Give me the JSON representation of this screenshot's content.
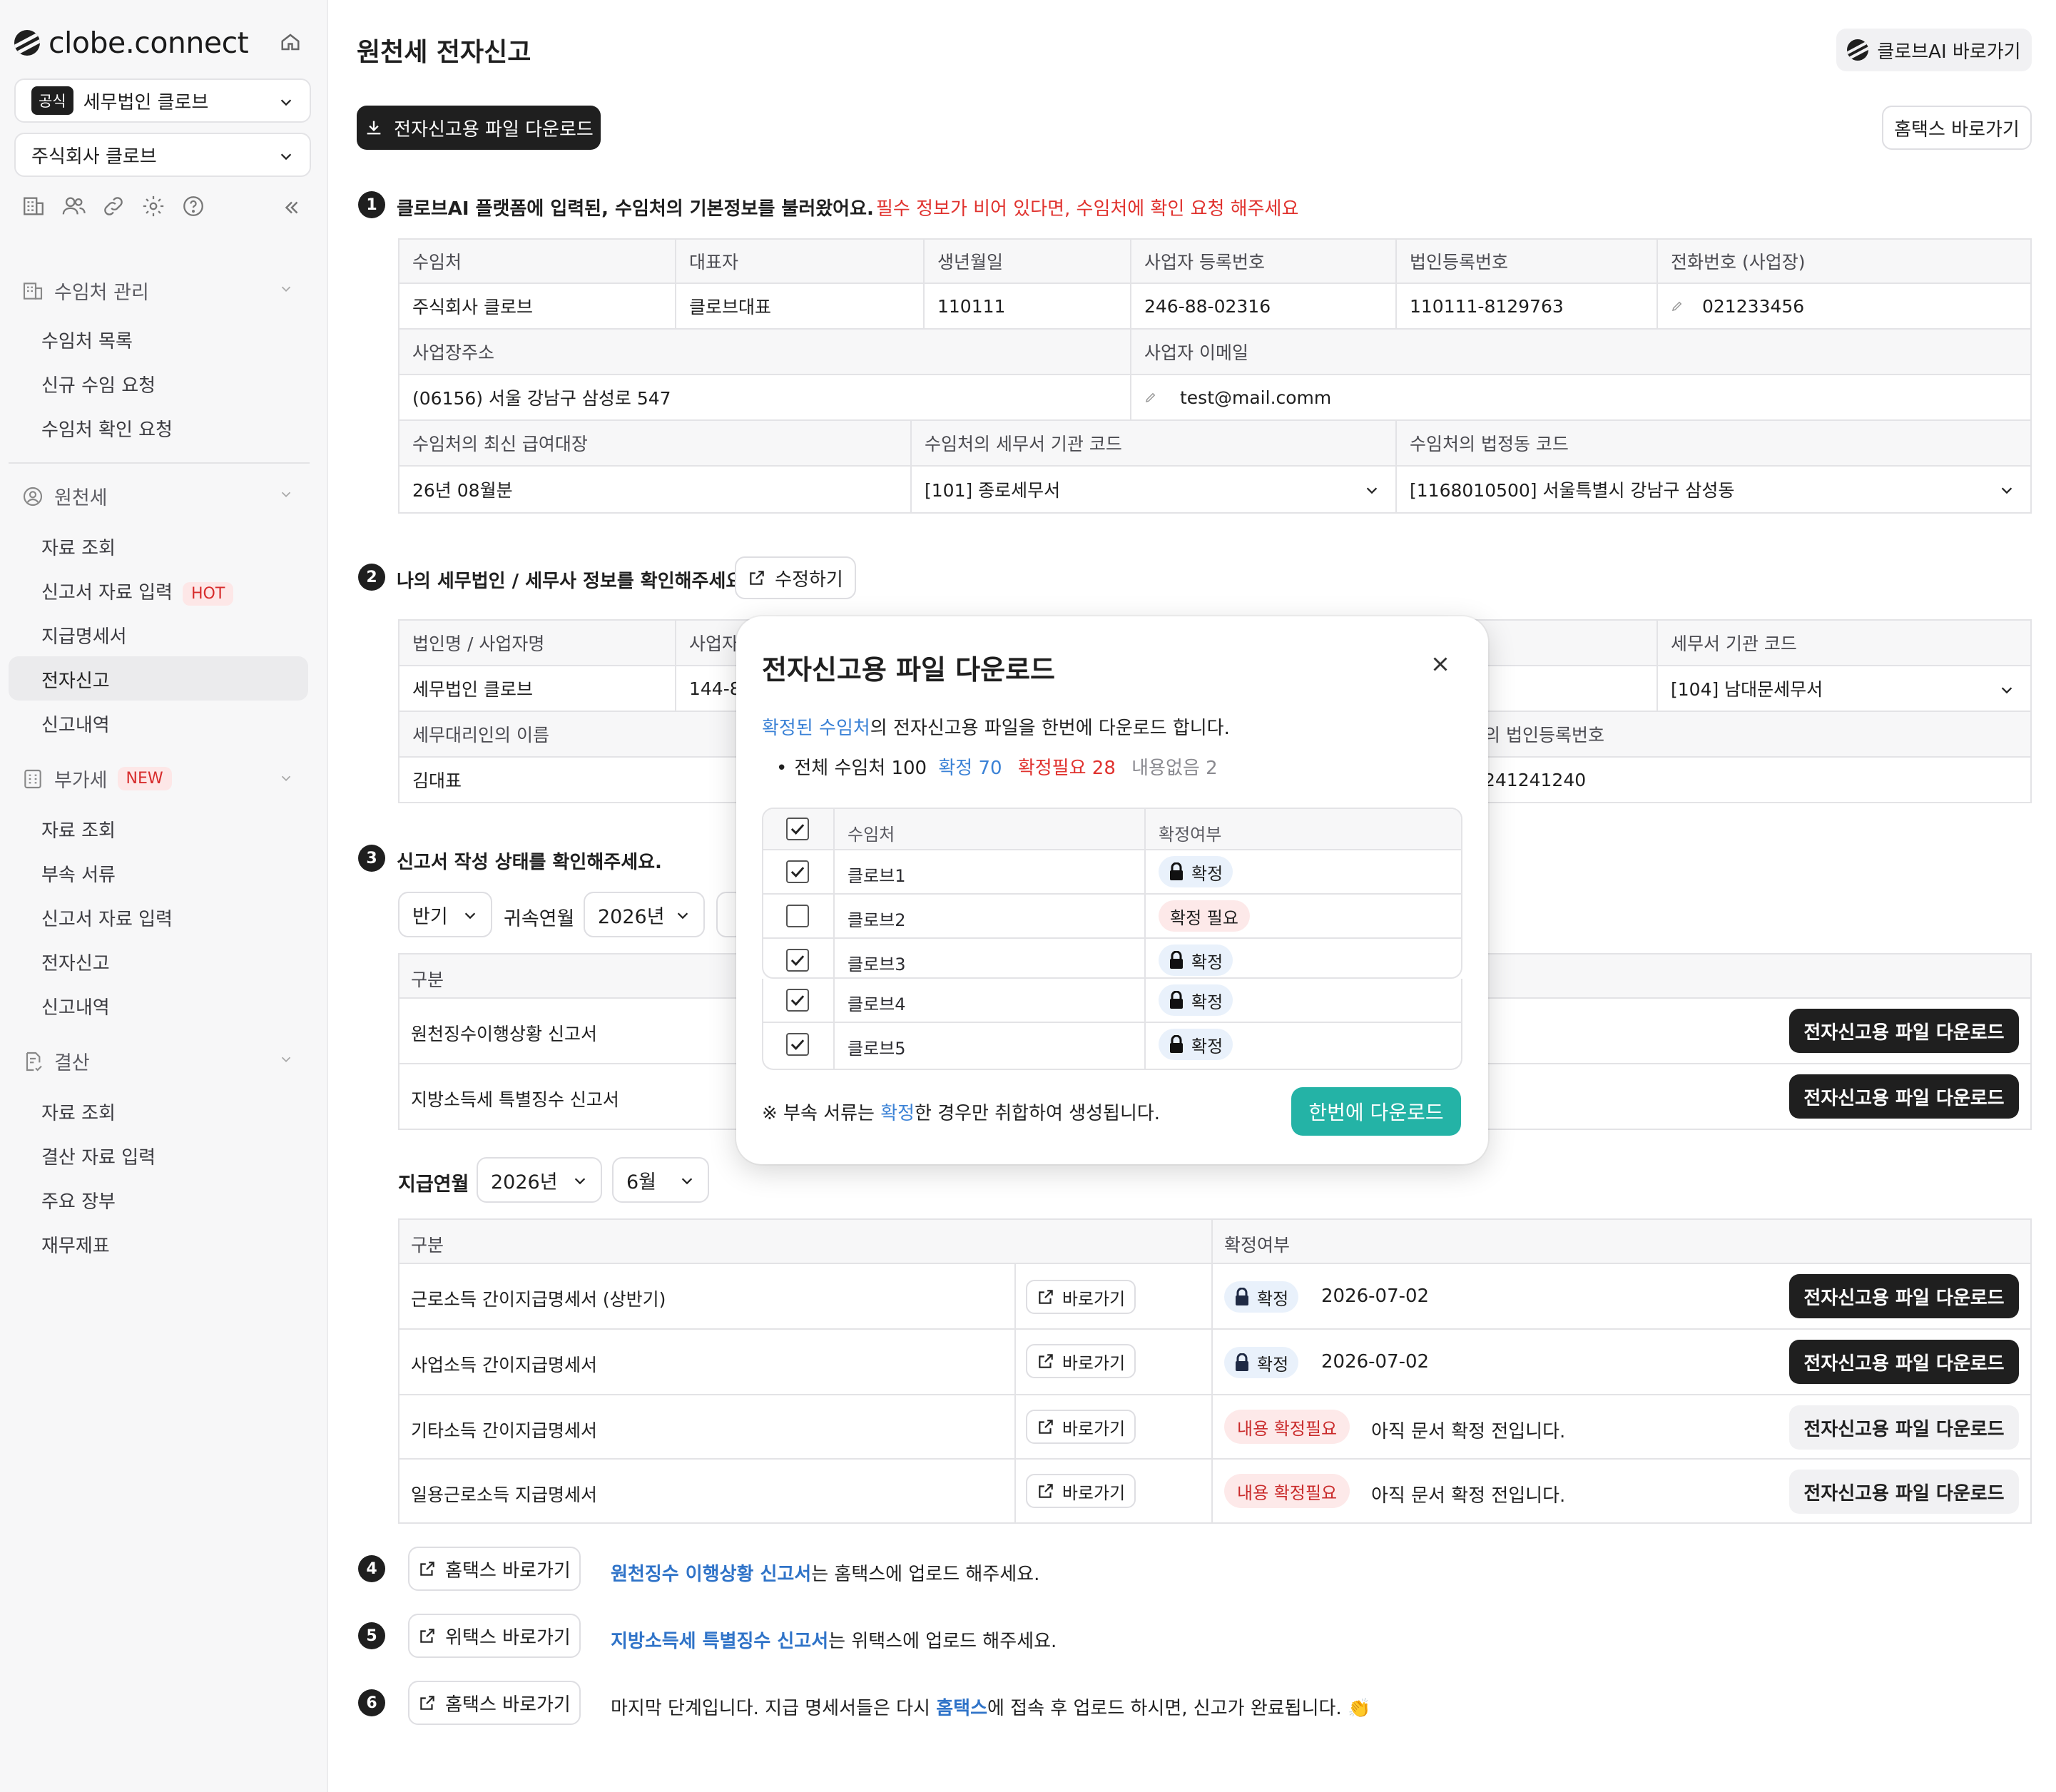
{
  "sidebar": {
    "logo": "clobe.connect",
    "firm_badge": "공식",
    "firm": "세무법인 클로브",
    "company": "주식회사 클로브",
    "sections": [
      {
        "title": "수임처 관리",
        "items": [
          "수임처 목록",
          "신규 수임 요청",
          "수임처 확인 요청"
        ]
      },
      {
        "title": "원천세",
        "items": [
          "자료 조회",
          "신고서 자료 입력",
          "지급명세서",
          "전자신고",
          "신고내역"
        ]
      },
      {
        "title": "부가세",
        "tag": "NEW",
        "items": [
          "자료 조회",
          "부속 서류",
          "신고서 자료 입력",
          "전자신고",
          "신고내역"
        ]
      },
      {
        "title": "결산",
        "items": [
          "자료 조회",
          "결산 자료 입력",
          "주요 장부",
          "재무제표"
        ]
      }
    ],
    "hot_tag": "HOT"
  },
  "header": {
    "title": "원천세 전자신고",
    "ai_button": "클로브AI 바로가기",
    "download_button": "전자신고용 파일 다운로드",
    "hometax_button": "홈택스 바로가기"
  },
  "step1": {
    "num": "1",
    "title": "클로브AI 플랫폼에 입력된, 수임처의 기본정보를 불러왔어요.",
    "warning": "필수 정보가 비어 있다면, 수임처에 확인 요청 해주세요",
    "h1": [
      "수임처",
      "대표자",
      "생년월일",
      "사업자 등록번호",
      "법인등록번호",
      "전화번호 (사업장)"
    ],
    "r1": [
      "주식회사 클로브",
      "클로브대표",
      "110111",
      "246-88-02316",
      "110111-8129763",
      "021233456"
    ],
    "h2": [
      "사업장주소",
      "사업자 이메일"
    ],
    "r2": [
      "(06156) 서울 강남구 삼성로 547",
      "test@mail.comm"
    ],
    "h3": [
      "수임처의 최신 급여대장",
      "수임처의 세무서 기관 코드",
      "수임처의 법정동 코드"
    ],
    "r3": [
      "26년 08월분",
      "[101] 종로세무서",
      "[1168010500] 서울특별시 강남구 삼성동"
    ]
  },
  "step2": {
    "num": "2",
    "title": "나의 세무법인 / 세무사 정보를 확인해주세요.",
    "edit_button": "수정하기",
    "h1": [
      "법인명 / 사업자명",
      "사업자",
      "세무서 기관 코드"
    ],
    "r1": [
      "세무법인 클로브",
      "144-8",
      "[104] 남대문세무서"
    ],
    "h2": [
      "세무대리인의 이름",
      "의 법인등록번호"
    ],
    "r2": [
      "김대표",
      "241241240"
    ]
  },
  "step3": {
    "num": "3",
    "title": "신고서 작성 상태를 확인해주세요.",
    "period": "반기",
    "attr_label": "귀속연월",
    "attr_year": "2026년",
    "section_header": "구분",
    "reports": [
      "원천징수이행상황 신고서",
      "지방소득세 특별징수 신고서"
    ],
    "pay_label": "지급연월",
    "pay_year": "2026년",
    "pay_month": "6월",
    "table_header": [
      "구분",
      "확정여부"
    ],
    "rows": [
      {
        "name": "근로소득 간이지급명세서 (상반기)",
        "go": "바로가기",
        "status": "확정",
        "date": "2026-07-02"
      },
      {
        "name": "사업소득 간이지급명세서",
        "go": "바로가기",
        "status": "확정",
        "date": "2026-07-02"
      },
      {
        "name": "기타소득 간이지급명세서",
        "go": "바로가기",
        "status": "내용 확정필요",
        "note": "아직 문서 확정 전입니다."
      },
      {
        "name": "일용근로소득 지급명세서",
        "go": "바로가기",
        "status": "내용 확정필요",
        "note": "아직 문서 확정 전입니다."
      }
    ],
    "download_label": "전자신고용 파일 다운로드"
  },
  "step4": {
    "num": "4",
    "button": "홈택스 바로가기",
    "link": "원천징수 이행상황 신고서",
    "text": "는 홈택스에 업로드 해주세요."
  },
  "step5": {
    "num": "5",
    "button": "위택스 바로가기",
    "link": "지방소득세 특별징수 신고서",
    "text": "는 위택스에 업로드 해주세요."
  },
  "step6": {
    "num": "6",
    "button": "홈택스 바로가기",
    "text1": "마지막 단계입니다. 지급 명세서들은 다시 ",
    "link": "홈택스",
    "text2": "에 접속 후 업로드 하시면, 신고가 완료됩니다. 👏"
  },
  "modal": {
    "title": "전자신고용 파일 다운로드",
    "desc_link": "확정된 수임처",
    "desc": "의 전자신고용 파일을 한번에 다운로드 합니다.",
    "sum_total": "전체 수임처 100",
    "sum_confirmed": "확정 70",
    "sum_need": "확정필요 28",
    "sum_none": "내용없음 2",
    "col_client": "수임처",
    "col_status": "확정여부",
    "rows": [
      {
        "name": "클로브1",
        "status": "확정",
        "checked": true
      },
      {
        "name": "클로브2",
        "status": "확정 필요",
        "checked": false
      },
      {
        "name": "클로브3",
        "status": "확정",
        "checked": true
      },
      {
        "name": "클로브4",
        "status": "확정",
        "checked": true
      },
      {
        "name": "클로브5",
        "status": "확정",
        "checked": true
      }
    ],
    "foot_pre": "※ 부속 서류는 ",
    "foot_link": "확정",
    "foot_post": "한 경우만 취합하여 생성됩니다.",
    "download_all": "한번에 다운로드"
  },
  "colors": {
    "accent_teal": "#24b3a6",
    "link_blue": "#3b82d6",
    "warn_red": "#e0322e",
    "dark": "#1f1f1f"
  }
}
